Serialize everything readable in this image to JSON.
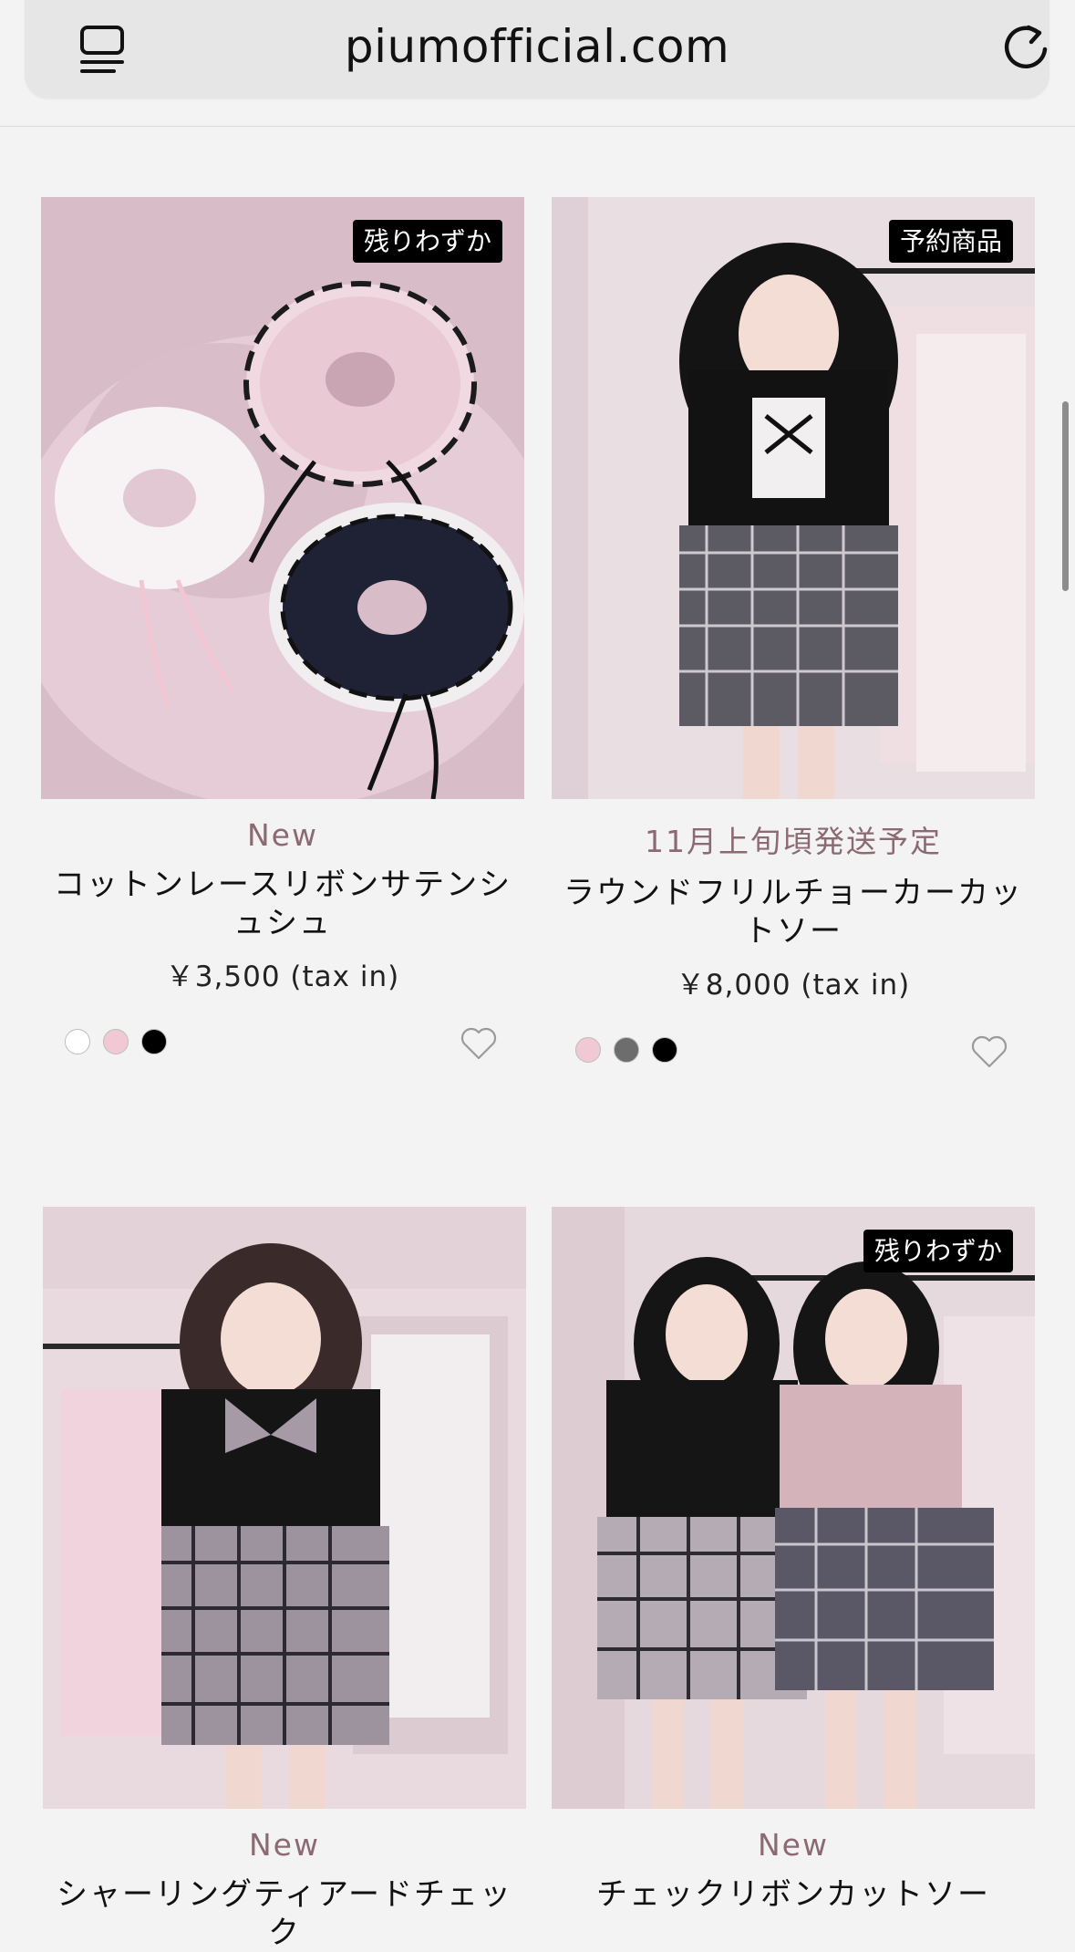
{
  "browser": {
    "url": "piumofficial.com",
    "menu_icon": "tab-overview-icon",
    "reload_icon": "reload-icon"
  },
  "products": [
    {
      "badge": "残りわずか",
      "status": "New",
      "name": "コットンレースリボンサテンシュシュ",
      "price": "￥3,500 (tax in)",
      "colors": [
        "#ffffff",
        "#f0c9d4",
        "#000000"
      ]
    },
    {
      "badge": "予約商品",
      "status": "11月上旬頃発送予定",
      "name": "ラウンドフリルチョーカーカットソー",
      "price": "￥8,000 (tax in)",
      "colors": [
        "#f0c9d4",
        "#6d6d6d",
        "#000000"
      ]
    },
    {
      "badge": "",
      "status": "New",
      "name": "シャーリングティアードチェック",
      "price": "",
      "colors": []
    },
    {
      "badge": "残りわずか",
      "status": "New",
      "name": "チェックリボンカットソー",
      "price": "",
      "colors": []
    }
  ],
  "icons": {
    "favorite": "heart-outline-icon"
  }
}
